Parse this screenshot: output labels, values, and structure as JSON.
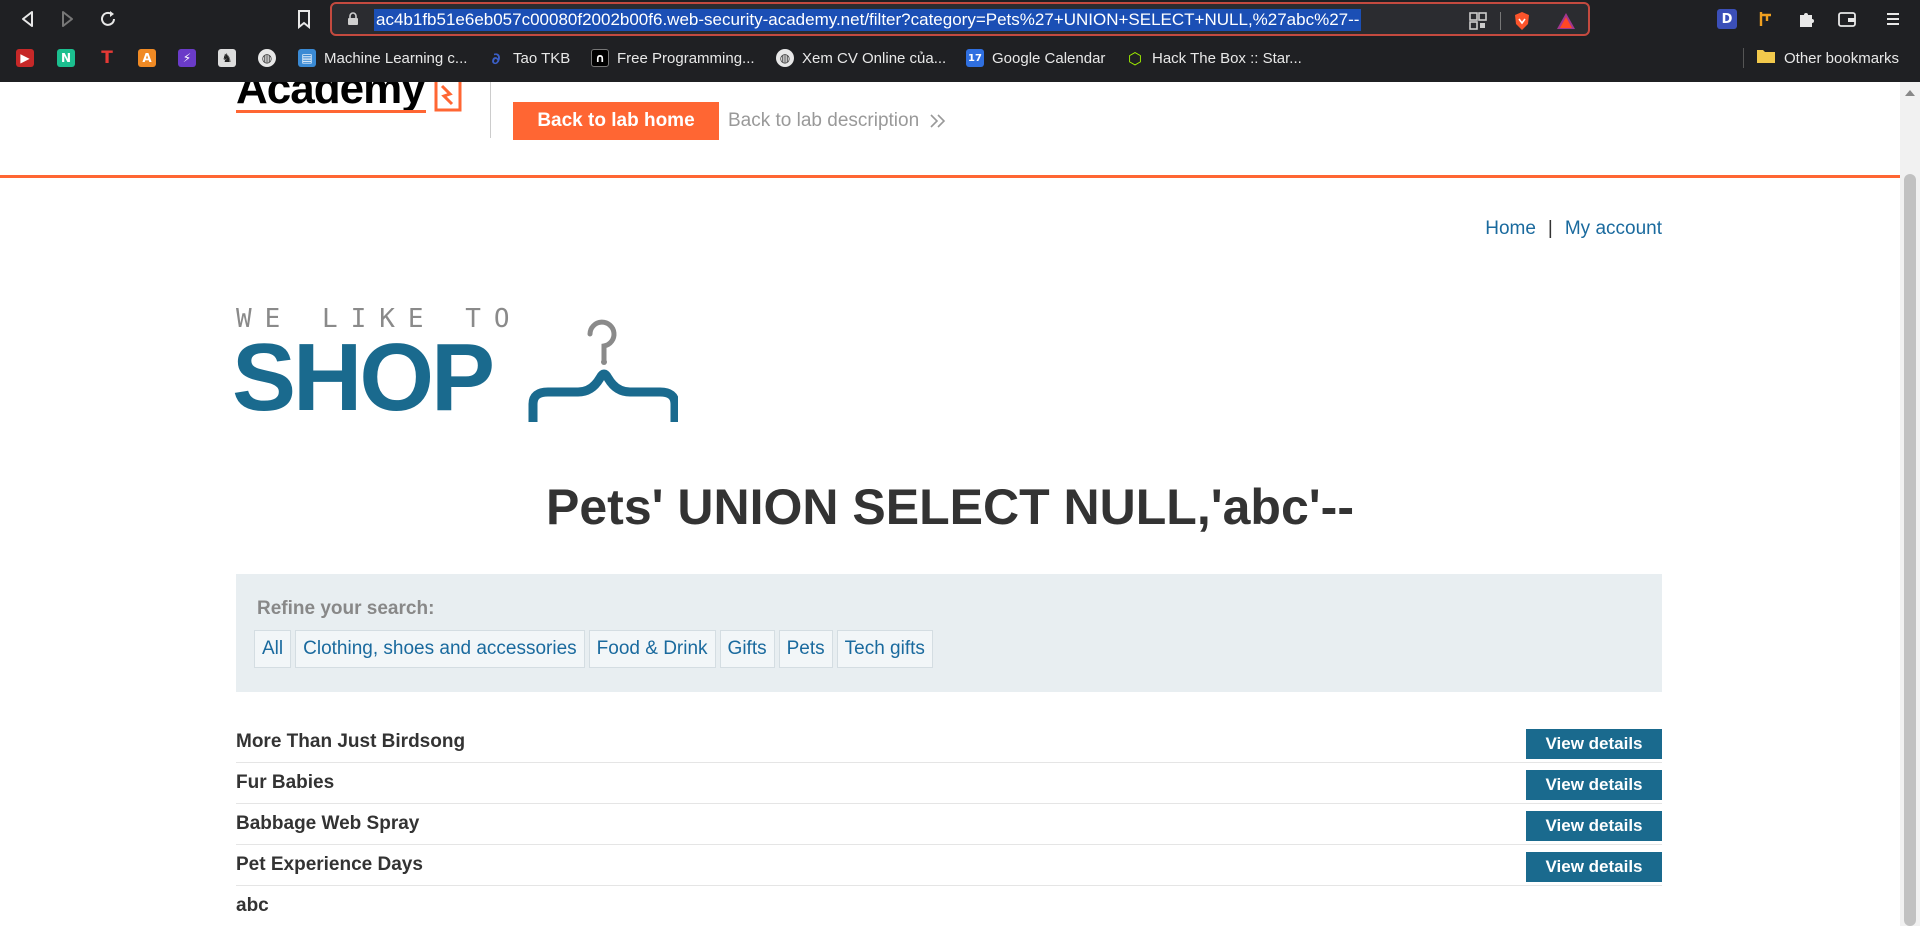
{
  "browser": {
    "url": "ac4b1fb51e6eb057c00080f2002b00f6.web-security-academy.net/filter?category=Pets%27+UNION+SELECT+NULL,%27abc%27--",
    "bookmarks": [
      {
        "label": "",
        "icon": "youtube-icon",
        "color": "#d33"
      },
      {
        "label": "",
        "icon": "notion-icon",
        "color": "#1bbf8f"
      },
      {
        "label": "",
        "icon": "t-icon",
        "color": "#e33"
      },
      {
        "label": "",
        "icon": "a-icon",
        "color": "#f08a24"
      },
      {
        "label": "",
        "icon": "bolt-icon",
        "color": "#6a3bc8"
      },
      {
        "label": "",
        "icon": "chess-icon",
        "color": "#444"
      },
      {
        "label": "",
        "icon": "globe-icon",
        "color": "#555"
      },
      {
        "label": "Machine Learning c...",
        "icon": "ml-icon",
        "color": "#3a8ad4"
      },
      {
        "label": "Tao TKB",
        "icon": "tkb-icon",
        "color": "#3b5fc8"
      },
      {
        "label": "Free Programming...",
        "icon": "fp-icon",
        "color": "#000"
      },
      {
        "label": "Xem CV Online của...",
        "icon": "globe-icon",
        "color": "#555"
      },
      {
        "label": "Google Calendar",
        "icon": "calendar-icon",
        "color": "#2f6fe0"
      },
      {
        "label": "Hack The Box :: Star...",
        "icon": "htb-icon",
        "color": "#9fef00"
      }
    ],
    "other_bookmarks": "Other bookmarks"
  },
  "lab_header": {
    "logo_text": "Academy",
    "back_home": "Back to lab home",
    "back_desc": "Back to lab description"
  },
  "nav": {
    "home": "Home",
    "separator": "|",
    "account": "My account"
  },
  "shop_logo": {
    "tagline": "WE LIKE TO",
    "word": "SHOP"
  },
  "heading": "Pets' UNION SELECT NULL,'abc'--",
  "filter": {
    "label": "Refine your search:",
    "categories": [
      "All",
      "Clothing, shoes and accessories",
      "Food & Drink",
      "Gifts",
      "Pets",
      "Tech gifts"
    ]
  },
  "products": [
    {
      "name": "More Than Just Birdsong",
      "button": "View details"
    },
    {
      "name": "Fur Babies",
      "button": "View details"
    },
    {
      "name": "Babbage Web Spray",
      "button": "View details"
    },
    {
      "name": "Pet Experience Days",
      "button": "View details"
    },
    {
      "name": "abc",
      "button": ""
    }
  ],
  "colors": {
    "accent": "#ff6633",
    "link": "#1a6a9e",
    "brand": "#1a6a8e"
  }
}
